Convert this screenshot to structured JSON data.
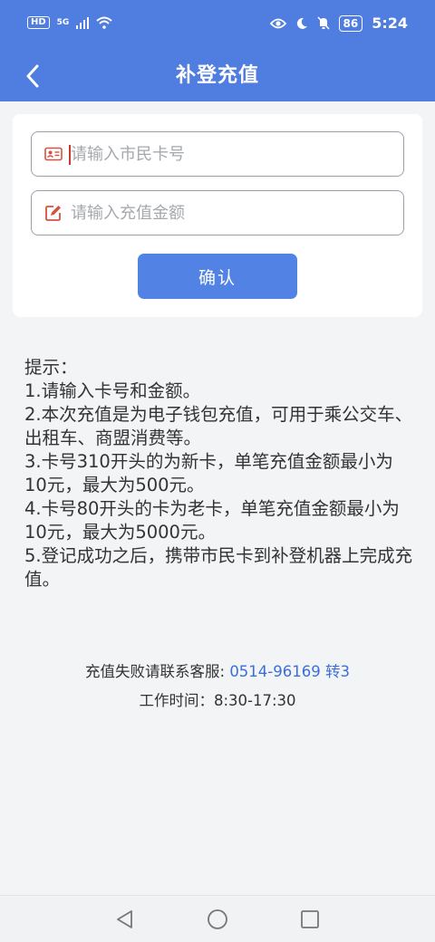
{
  "status_bar": {
    "hd_badge": "HD",
    "network": "5G",
    "battery": "86",
    "time": "5:24"
  },
  "header": {
    "title": "补登充值"
  },
  "form": {
    "card_number_placeholder": "请输入市民卡号",
    "amount_placeholder": "请输入充值金额",
    "confirm_label": "确认"
  },
  "tips": {
    "heading": "提示：",
    "lines": [
      "1.请输入卡号和金额。",
      "2.本次充值是为电子钱包充值，可用于乘公交车、出租车、商盟消费等。",
      "3.卡号310开头的为新卡，单笔充值金额最小为10元，最大为500元。",
      "4.卡号80开头的卡为老卡，单笔充值金额最小为10元，最大为5000元。",
      "5.登记成功之后，携带市民卡到补登机器上完成充值。"
    ]
  },
  "contact": {
    "label": "充值失败请联系客服:",
    "phone": "0514-96169 转3",
    "hours": "工作时间：8:30-17:30"
  },
  "colors": {
    "header_blue": "#4f7de0",
    "button_blue": "#5283e4",
    "link_blue": "#3a6fdb",
    "icon_red": "#d9503f"
  }
}
